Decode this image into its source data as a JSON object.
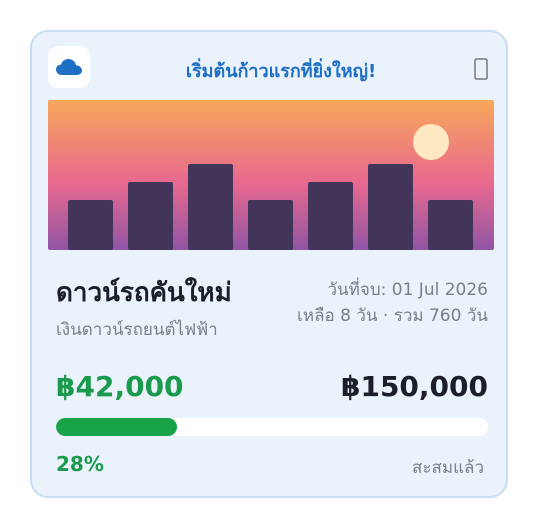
{
  "header": {
    "title": "เริ่มต้นก้าวแรกที่ยิ่งใหญ่!",
    "logo_icon": "cloud-icon",
    "menu_icon": "more-icon"
  },
  "goal": {
    "name": "ดาวน์รถคันใหม่",
    "description": "เงินดาวน์รถยนต์ไฟฟ้า",
    "end_date": "วันที่จบ: 01 Jul 2026",
    "remaining": "เหลือ 8 วัน · รวม 760 วัน"
  },
  "amounts": {
    "saved": "฿42,000",
    "target": "฿150,000"
  },
  "progress": {
    "fraction": 0.28,
    "percent_label": "28%",
    "status_label": "สะสมแล้ว"
  },
  "colors": {
    "accent": "#1f6fc5",
    "success": "#19a349",
    "card_bg": "#eaf2fc"
  }
}
